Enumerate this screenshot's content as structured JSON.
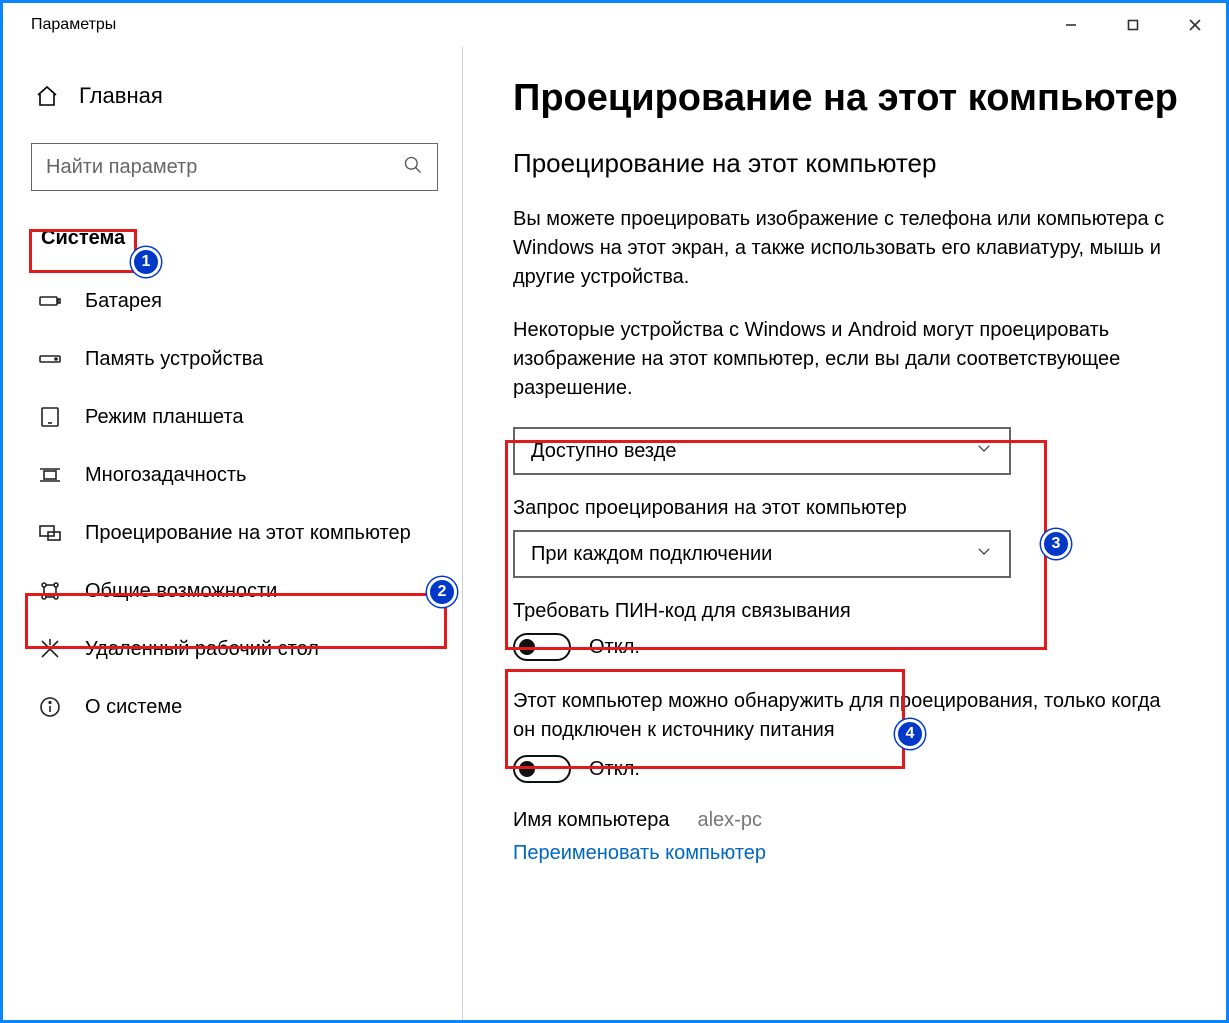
{
  "window": {
    "title": "Параметры"
  },
  "sidebar": {
    "home": "Главная",
    "search_placeholder": "Найти параметр",
    "category": "Система",
    "items": [
      {
        "label": "Батарея"
      },
      {
        "label": "Память устройства"
      },
      {
        "label": "Режим планшета"
      },
      {
        "label": "Многозадачность"
      },
      {
        "label": "Проецирование на этот компьютер"
      },
      {
        "label": "Общие возможности"
      },
      {
        "label": "Удаленный рабочий стол"
      },
      {
        "label": "О системе"
      }
    ]
  },
  "main": {
    "title": "Проецирование на этот компьютер",
    "subtitle": "Проецирование на этот компьютер",
    "para1": "Вы можете проецировать изображение с телефона или компьютера с Windows на этот экран, а также использовать его клавиатуру, мышь и другие устройства.",
    "para2": "Некоторые устройства с Windows и Android могут проецировать изображение на этот компьютер, если вы дали соответствующее разрешение.",
    "dropdown1_value": "Доступно везде",
    "field2_label": "Запрос проецирования на этот компьютер",
    "dropdown2_value": "При каждом подключении",
    "pin_label": "Требовать ПИН-код для связывания",
    "toggle_off": "Откл.",
    "power_label": "Этот компьютер можно обнаружить для проецирования, только когда он подключен к источнику питания",
    "pcname_label": "Имя компьютера",
    "pcname_value": "alex-pc",
    "rename_link": "Переименовать компьютер"
  },
  "badges": {
    "b1": "1",
    "b2": "2",
    "b3": "3",
    "b4": "4"
  }
}
